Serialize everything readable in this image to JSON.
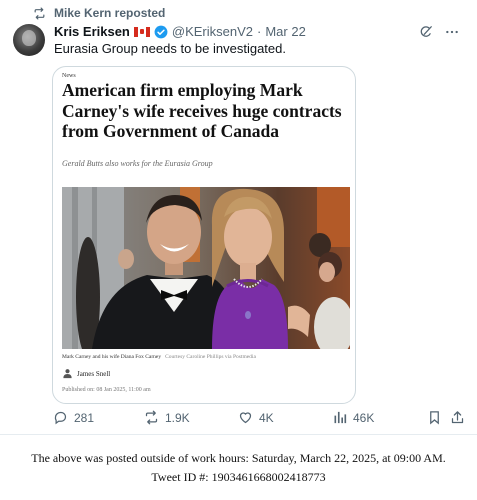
{
  "repost": {
    "label": "Mike Kern reposted",
    "icon": "repost-icon"
  },
  "tweet": {
    "author_name": "Kris Eriksen",
    "flag": "canada-flag-icon",
    "handle": "@KEriksenV2",
    "separator": "·",
    "date": "Mar 22",
    "text": "Eurasia Group needs to be investigated."
  },
  "article": {
    "section": "News",
    "headline": "American firm employing Mark Carney's wife receives huge contracts from Government of Canada",
    "subhead": "Gerald Butts also works for the Eurasia Group",
    "caption": "Mark Carney and his wife Diana Fox Carney",
    "credit": "Courtesy Caroline Phillips via Postmedia",
    "author": "James Snell",
    "published": "Published on: 08 Jan 2025, 11:00 am"
  },
  "actions": {
    "replies": "281",
    "reposts": "1.9K",
    "likes": "4K",
    "views": "46K"
  },
  "footer": {
    "line1": "The above was posted outside of work hours: Saturday, March 22, 2025, at 09:00 AM.",
    "line2": "Tweet ID #: 1903461668002418773"
  },
  "colors": {
    "secondary_text": "#536471",
    "verified": "#1d9bf0",
    "border": "#cfd9de"
  }
}
